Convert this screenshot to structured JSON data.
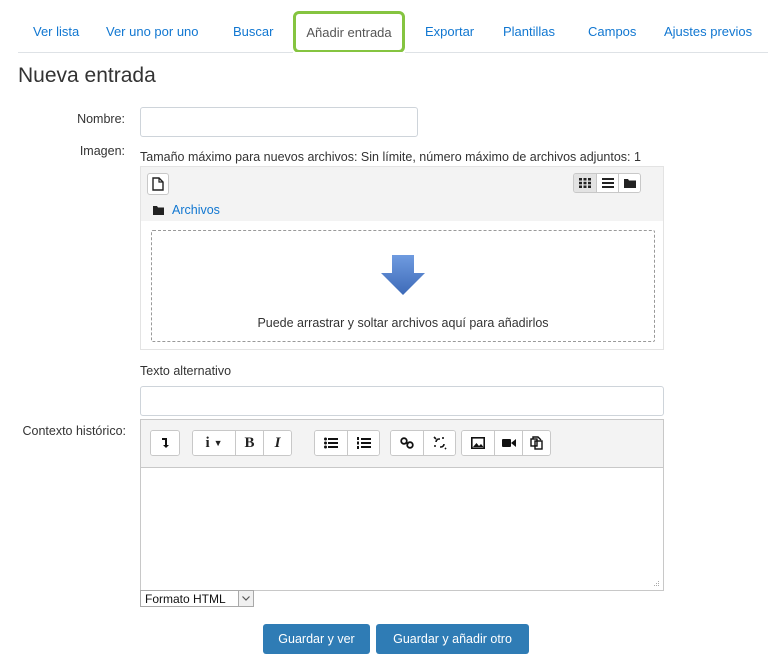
{
  "tabs": {
    "items": [
      "Ver lista",
      "Ver uno por uno",
      "Buscar",
      "Añadir entrada",
      "Exportar",
      "Plantillas",
      "Campos",
      "Ajustes previos"
    ],
    "active": "Añadir entrada"
  },
  "page_title": "Nueva entrada",
  "form": {
    "nombre_label": "Nombre:",
    "nombre_value": "",
    "imagen_label": "Imagen:",
    "filepicker_info": "Tamaño máximo para nuevos archivos: Sin límite, número máximo de archivos adjuntos: 1",
    "folder_label": "Archivos",
    "drop_text": "Puede arrastrar y soltar archivos aquí para añadirlos",
    "alt_label": "Texto alternativo",
    "alt_value": "",
    "contexto_label": "Contexto histórico:",
    "format_value": "Formato HTML"
  },
  "buttons": {
    "save_view": "Guardar y ver",
    "save_add": "Guardar y añadir otro"
  },
  "editor_toolbar": {
    "info": "i",
    "bold": "B",
    "italic": "I"
  },
  "colors": {
    "link": "#1177d1",
    "active_tab_highlight": "#85c440",
    "primary_button": "#2f7cb5",
    "arrow": "#4f7dc9"
  },
  "icons": [
    "add-file-icon",
    "grid-view-icon",
    "list-view-icon",
    "tree-view-icon",
    "folder-icon",
    "download-arrow-icon",
    "collapse-icon",
    "info-icon",
    "bold-icon",
    "italic-icon",
    "bullet-list-icon",
    "numbered-list-icon",
    "link-icon",
    "unlink-icon",
    "image-icon",
    "video-icon",
    "manage-files-icon"
  ]
}
